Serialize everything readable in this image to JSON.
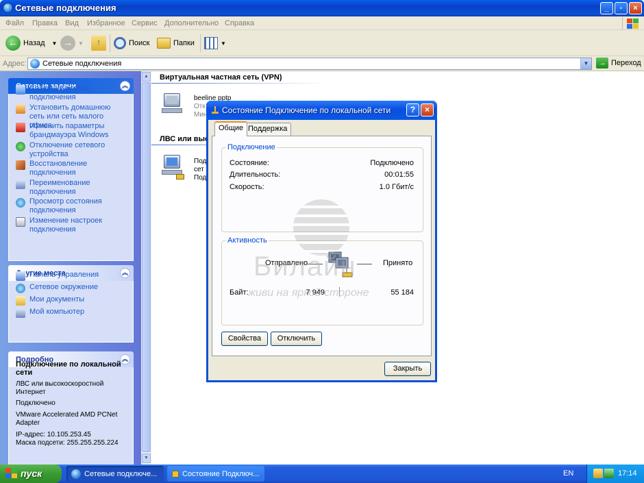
{
  "window": {
    "title": "Сетевые подключения",
    "menu": [
      "Файл",
      "Правка",
      "Вид",
      "Избранное",
      "Сервис",
      "Дополнительно",
      "Справка"
    ],
    "toolbar": {
      "back": "Назад",
      "search": "Поиск",
      "folders": "Папки"
    },
    "address": {
      "label": "Адрес:",
      "value": "Сетевые подключения",
      "go": "Переход"
    }
  },
  "left_pane": {
    "network_tasks": {
      "title": "Сетевые задачи",
      "items": [
        "Создание нового подключения",
        "Установить домашнюю сеть или сеть малого офиса",
        "Изменить параметры брандмауэра Windows",
        "Отключение сетевого устройства",
        "Восстановление подключения",
        "Переименование подключения",
        "Просмотр состояния подключения",
        "Изменение настроек подключения"
      ]
    },
    "other_places": {
      "title": "Другие места",
      "items": [
        "Панель управления",
        "Сетевое окружение",
        "Мои документы",
        "Мой компьютер"
      ]
    },
    "details": {
      "title": "Подробно",
      "name": "Подключение по локальной сети",
      "type": "ЛВС или высокоскоростной Интернет",
      "status": "Подключено",
      "adapter": "VMware Accelerated AMD PCNet Adapter",
      "ip": "IP-адрес: 10.105.253.45",
      "mask": "Маска подсети: 255.255.255.224"
    }
  },
  "content": {
    "vpn_group": "Виртуальная частная сеть (VPN)",
    "vpn_item": {
      "name": "beeline pptp",
      "line2": "Отк",
      "line3": "Мин"
    },
    "lan_group": "ЛВС или высо",
    "lan_item": {
      "line1": "Под",
      "line2": "сет",
      "line3": "Под"
    }
  },
  "dialog": {
    "title": "Состояние Подключение по локальной сети",
    "tabs": [
      "Общие",
      "Поддержка"
    ],
    "connection": {
      "legend": "Подключение",
      "status_label": "Состояние:",
      "status_value": "Подключено",
      "duration_label": "Длительность:",
      "duration_value": "00:01:55",
      "speed_label": "Скорость:",
      "speed_value": "1.0 Гбит/с"
    },
    "activity": {
      "legend": "Активность",
      "sent_label": "Отправлено",
      "received_label": "Принято",
      "bytes_label": "Байт:",
      "bytes_sent": "7 949",
      "bytes_received": "55 184"
    },
    "buttons": {
      "properties": "Свойства",
      "disable": "Отключить",
      "close": "Закрыть"
    },
    "watermark": {
      "brand": "Билайн",
      "slogan": "живи на яркой стороне"
    }
  },
  "taskbar": {
    "start": "пуск",
    "buttons": [
      "Сетевые подключе...",
      "Состояние Подключ..."
    ],
    "lang": "EN",
    "clock": "17:14"
  },
  "colors": {
    "xp_blue": "#0a50d8",
    "link": "#215dc6",
    "start_green": "#3a9a32"
  }
}
